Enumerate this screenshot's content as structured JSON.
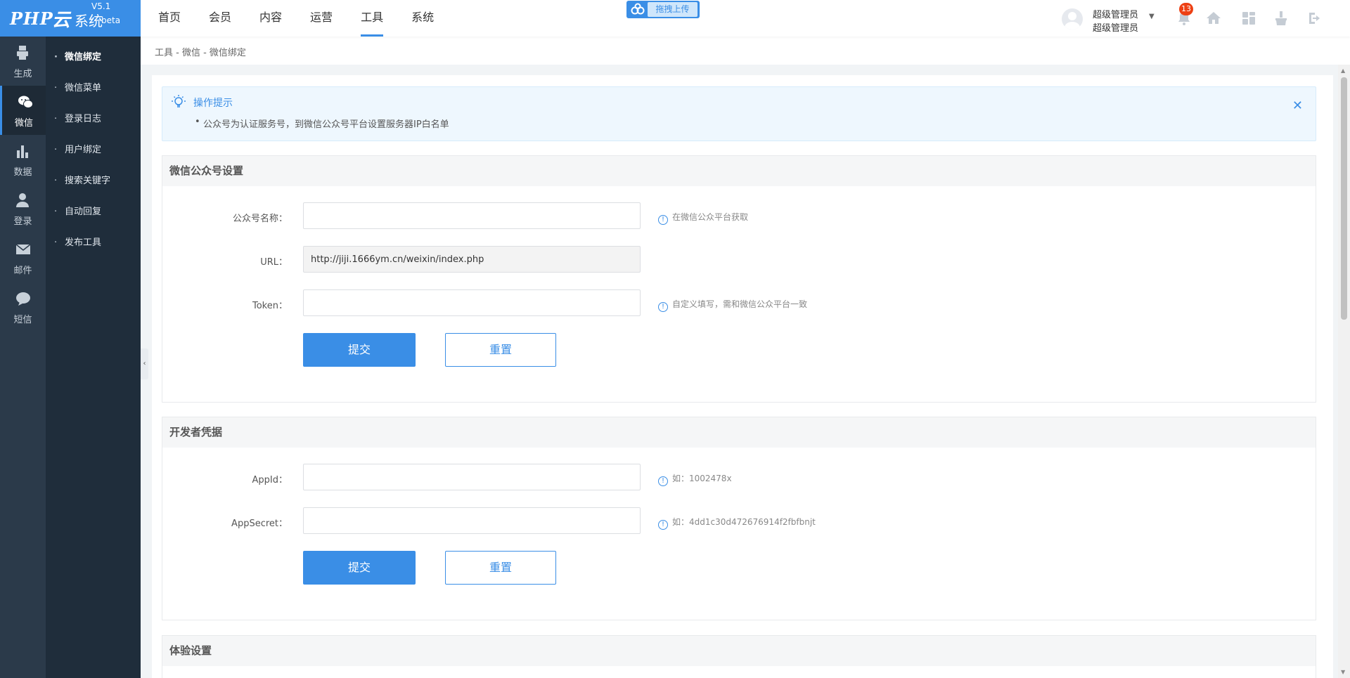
{
  "app": {
    "logo_php": "PHP",
    "logo_cloud": "云",
    "logo_sys": "系统",
    "version": "V5.1",
    "beta": "beta"
  },
  "topnav": [
    "首页",
    "会员",
    "内容",
    "运营",
    "工具",
    "系统"
  ],
  "topnav_active": "工具",
  "upload_label": "拖拽上传",
  "user": {
    "name1": "超级管理员",
    "name2": "超级管理员"
  },
  "notifications": "13",
  "iconbar": [
    {
      "label": "生成",
      "icon": "printer-icon"
    },
    {
      "label": "微信",
      "icon": "wechat-icon"
    },
    {
      "label": "数据",
      "icon": "bar-chart-icon"
    },
    {
      "label": "登录",
      "icon": "user-icon"
    },
    {
      "label": "邮件",
      "icon": "mail-icon"
    },
    {
      "label": "短信",
      "icon": "message-icon"
    }
  ],
  "iconbar_active": "微信",
  "submenu": [
    "微信绑定",
    "微信菜单",
    "登录日志",
    "用户绑定",
    "搜索关键字",
    "自动回复",
    "发布工具"
  ],
  "submenu_active": "微信绑定",
  "breadcrumb": "工具 - 微信 - 微信绑定",
  "tips": {
    "title": "操作提示",
    "line": "公众号为认证服务号，到微信公众号平台设置服务器IP白名单"
  },
  "section1": {
    "title": "微信公众号设置",
    "fields": [
      {
        "label": "公众号名称：",
        "value": "",
        "hint": "在微信公众平台获取"
      },
      {
        "label": "URL：",
        "value": "http://jiji.1666ym.cn/weixin/index.php",
        "hint": ""
      },
      {
        "label": "Token：",
        "value": "",
        "hint": "自定义填写，需和微信公众平台一致"
      }
    ],
    "submit": "提交",
    "reset": "重置"
  },
  "section2": {
    "title": "开发者凭据",
    "fields": [
      {
        "label": "AppId：",
        "value": "",
        "hint": "如：1002478x"
      },
      {
        "label": "AppSecret：",
        "value": "",
        "hint": "如：4dd1c30d472676914f2fbfbnjt"
      }
    ],
    "submit": "提交",
    "reset": "重置"
  },
  "section3": {
    "title": "体验设置"
  },
  "colors": {
    "accent": "#3a8ee6",
    "sidebar_dark": "#2b3a4a",
    "submenu_dark": "#1f2d3b",
    "badge": "#ed4014"
  }
}
